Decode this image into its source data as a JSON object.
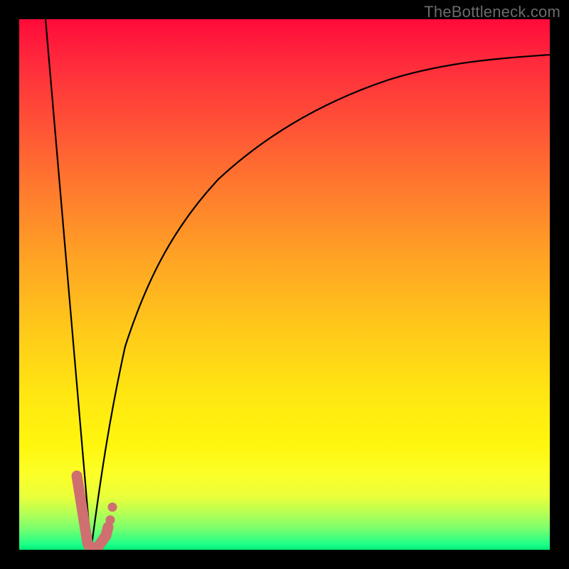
{
  "watermark": "TheBottleneck.com",
  "chart_data": {
    "type": "line",
    "title": "",
    "xlabel": "",
    "ylabel": "",
    "xlim": [
      0,
      100
    ],
    "ylim": [
      0,
      100
    ],
    "grid": false,
    "legend": false,
    "series": [
      {
        "name": "left-line",
        "stroke": "#000000",
        "x": [
          5,
          13.5
        ],
        "y": [
          100,
          0
        ]
      },
      {
        "name": "log-curve",
        "stroke": "#000000",
        "x": [
          13.5,
          15,
          17,
          20,
          24,
          30,
          38,
          48,
          60,
          74,
          88,
          100
        ],
        "y": [
          0,
          14,
          26,
          38,
          49,
          60,
          70,
          78,
          84,
          88.5,
          91.5,
          93.5
        ]
      },
      {
        "name": "salmon-stroke",
        "stroke": "#d07070",
        "x": [
          10.8,
          12.9,
          13.3,
          14.8,
          16.3,
          16.7
        ],
        "y": [
          14,
          1.3,
          0.4,
          0.4,
          2.7,
          4.3
        ]
      },
      {
        "name": "salmon-dots",
        "stroke": "#d07070",
        "type_override": "scatter",
        "x": [
          17.2,
          17.6
        ],
        "y": [
          5.6,
          8.0
        ]
      }
    ],
    "background_gradient_stops": [
      {
        "pos": 0,
        "color": "#ff0a3a"
      },
      {
        "pos": 8,
        "color": "#ff2a3c"
      },
      {
        "pos": 20,
        "color": "#ff5236"
      },
      {
        "pos": 32,
        "color": "#ff7a2e"
      },
      {
        "pos": 45,
        "color": "#ffa324"
      },
      {
        "pos": 58,
        "color": "#ffc81a"
      },
      {
        "pos": 70,
        "color": "#ffe512"
      },
      {
        "pos": 80,
        "color": "#fff60e"
      },
      {
        "pos": 86,
        "color": "#fbff28"
      },
      {
        "pos": 90,
        "color": "#e9ff3a"
      },
      {
        "pos": 93,
        "color": "#b7ff54"
      },
      {
        "pos": 96,
        "color": "#7aff6e"
      },
      {
        "pos": 99,
        "color": "#1bff88"
      },
      {
        "pos": 100,
        "color": "#00eb74"
      }
    ]
  }
}
